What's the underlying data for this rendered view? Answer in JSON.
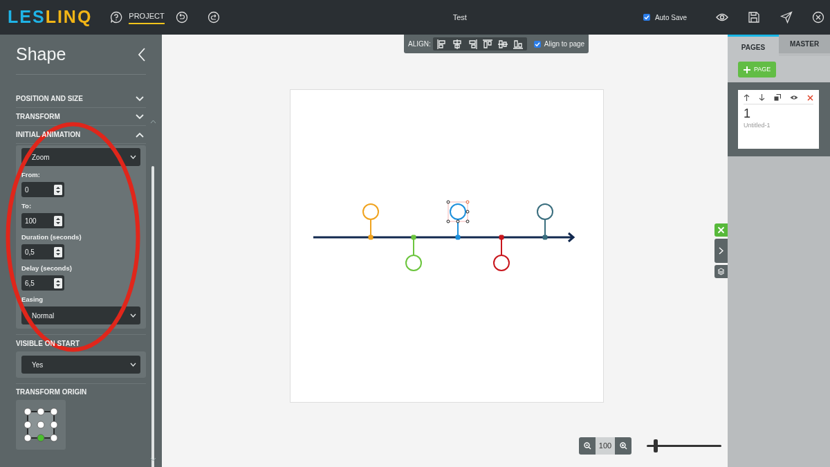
{
  "topbar": {
    "logo": [
      {
        "text": "LES",
        "color": "#1fb3e6"
      },
      {
        "text": "LINQ",
        "color": "#f2b516"
      }
    ],
    "nav_label": "PROJECT",
    "title": "Test",
    "auto_save": {
      "label": "Auto Save",
      "checked": true
    }
  },
  "panel": {
    "title": "Shape",
    "sections": [
      {
        "title": "POSITION AND SIZE",
        "expanded": false
      },
      {
        "title": "TRANSFORM",
        "expanded": false
      },
      {
        "title": "INITIAL ANIMATION",
        "expanded": true
      }
    ],
    "animation": {
      "effect": "Zoom",
      "fields": [
        {
          "label": "From:",
          "value": "0"
        },
        {
          "label": "To:",
          "value": "100"
        },
        {
          "label": "Duration (seconds)",
          "value": "0,5"
        },
        {
          "label": "Delay (seconds)",
          "value": "6,5"
        }
      ],
      "easing_label": "Easing",
      "easing": "Normal"
    },
    "visible_on_start": {
      "title": "VISIBLE ON START",
      "value": "Yes"
    },
    "transform_origin": {
      "title": "TRANSFORM ORIGIN",
      "points": [
        {
          "selected": false
        },
        {
          "selected": false
        },
        {
          "selected": false
        },
        {
          "selected": false
        },
        {
          "selected": false
        },
        {
          "selected": false
        },
        {
          "selected": false
        },
        {
          "selected": true
        },
        {
          "selected": false
        }
      ]
    }
  },
  "align_toolbar": {
    "label": "ALIGN:",
    "align_to_page": {
      "label": "Align to page",
      "checked": true
    }
  },
  "timeline": {
    "markers": [
      {
        "kind": "above",
        "color": "#f0a31f",
        "selected": false
      },
      {
        "kind": "below",
        "color": "#6cc53e",
        "selected": false
      },
      {
        "kind": "above",
        "color": "#1e90dc",
        "selected": true
      },
      {
        "kind": "below",
        "color": "#c8161d",
        "selected": false
      },
      {
        "kind": "above",
        "color": "#3a6e7e",
        "selected": false
      }
    ]
  },
  "zoom": {
    "value": "100",
    "level": 0.12
  },
  "pages_panel": {
    "tabs": [
      {
        "label": "PAGES",
        "selected": true
      },
      {
        "label": "MASTER",
        "selected": false
      }
    ],
    "add_button": "PAGE",
    "pages": [
      {
        "number": "1",
        "name": "Untitled-1"
      }
    ]
  }
}
